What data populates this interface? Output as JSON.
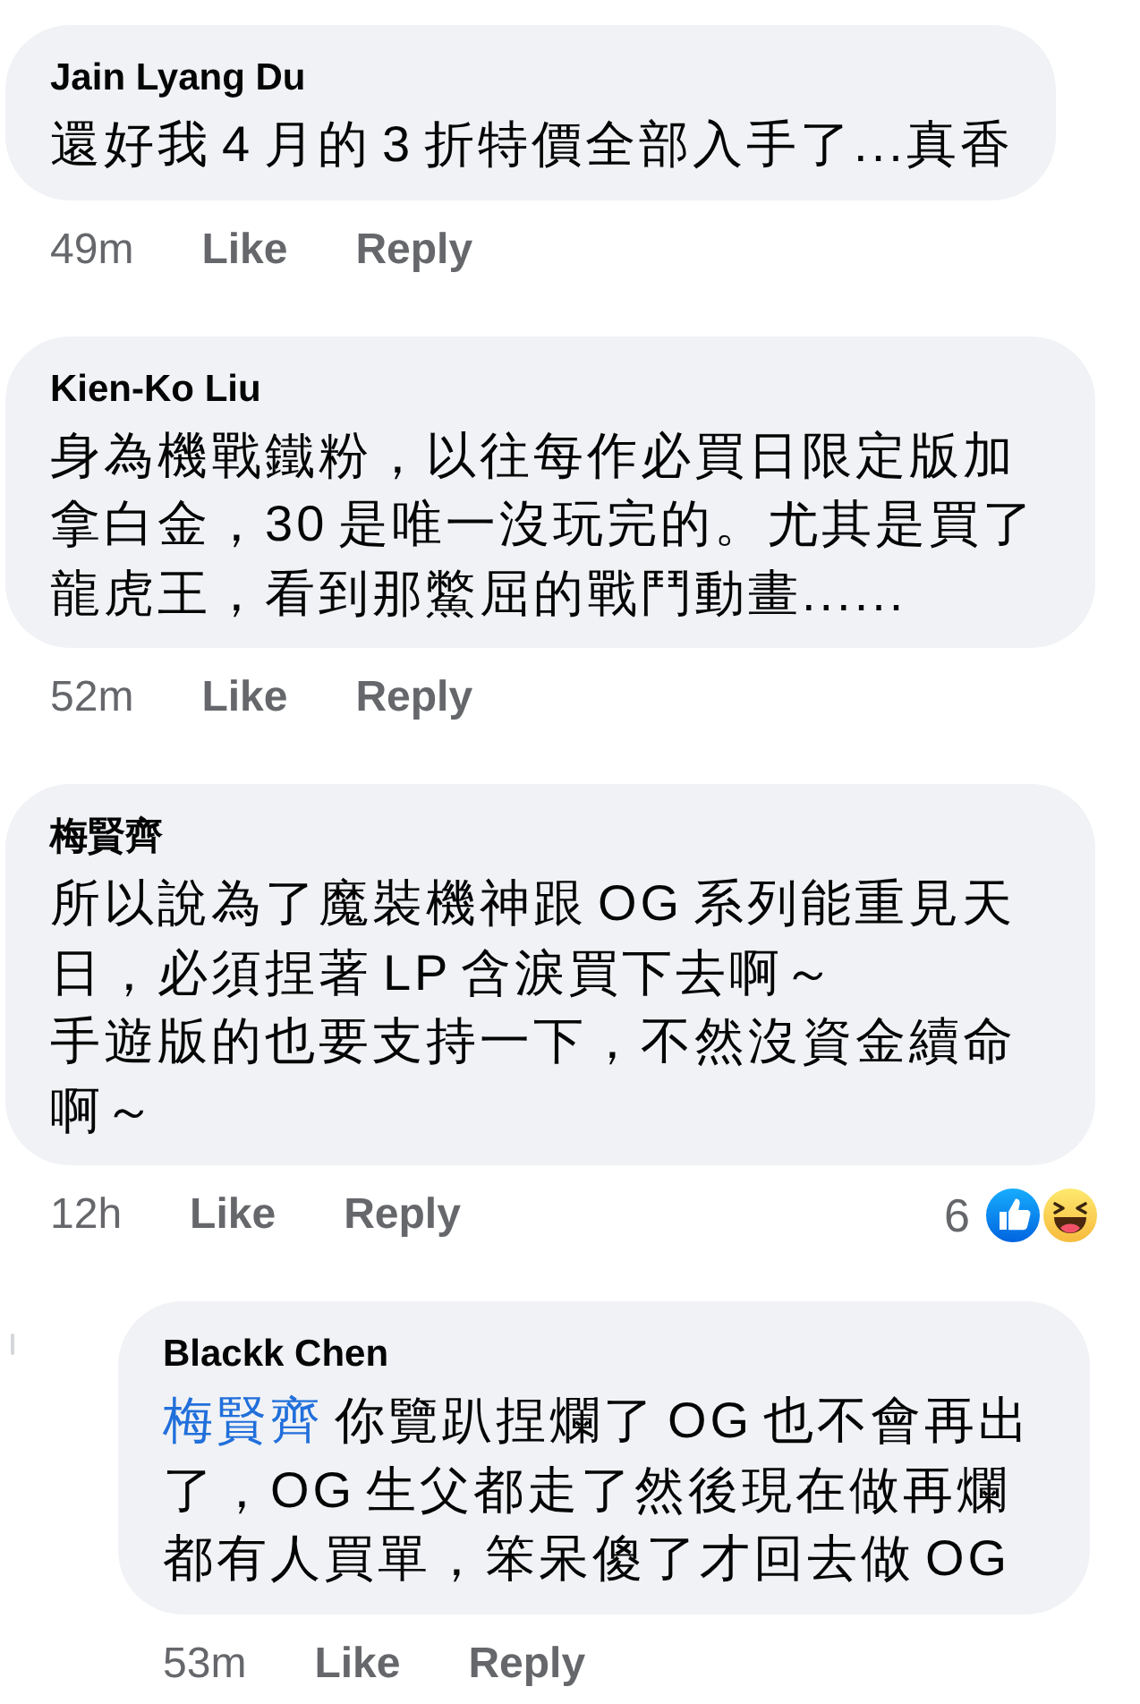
{
  "comments": [
    {
      "author": "Jain Lyang Du",
      "paragraphs": [
        "還好我 4 月的 3 折特價全部入手了...真香"
      ],
      "time": "49m",
      "actions": [
        "Like",
        "Reply"
      ]
    },
    {
      "author": "Kien-Ko Liu",
      "paragraphs": [
        "身為機戰鐵粉，以往每作必買日限定版加拿白金，30 是唯一沒玩完的。尤其是買了龍虎王，看到那鱉屈的戰鬥動畫......"
      ],
      "time": "52m",
      "actions": [
        "Like",
        "Reply"
      ]
    },
    {
      "author": "梅賢齊",
      "paragraphs": [
        "所以說為了魔裝機神跟 OG 系列能重見天日，必須捏著 LP 含淚買下去啊～",
        "手遊版的也要支持一下，不然沒資金續命啊～"
      ],
      "time": "12h",
      "actions": [
        "Like",
        "Reply"
      ],
      "reactions": {
        "count": "6",
        "icons": [
          {
            "kind": "like"
          },
          {
            "kind": "haha"
          }
        ]
      },
      "replies": [
        {
          "author": "Blackk Chen",
          "mention": "梅賢齊",
          "paragraphs": [
            "你覽趴捏爛了 OG 也不會再出了，OG 生父都走了然後現在做再爛都有人買單，笨呆傻了才回去做 OG"
          ],
          "time": "53m",
          "actions": [
            "Like",
            "Reply"
          ]
        }
      ]
    }
  ]
}
